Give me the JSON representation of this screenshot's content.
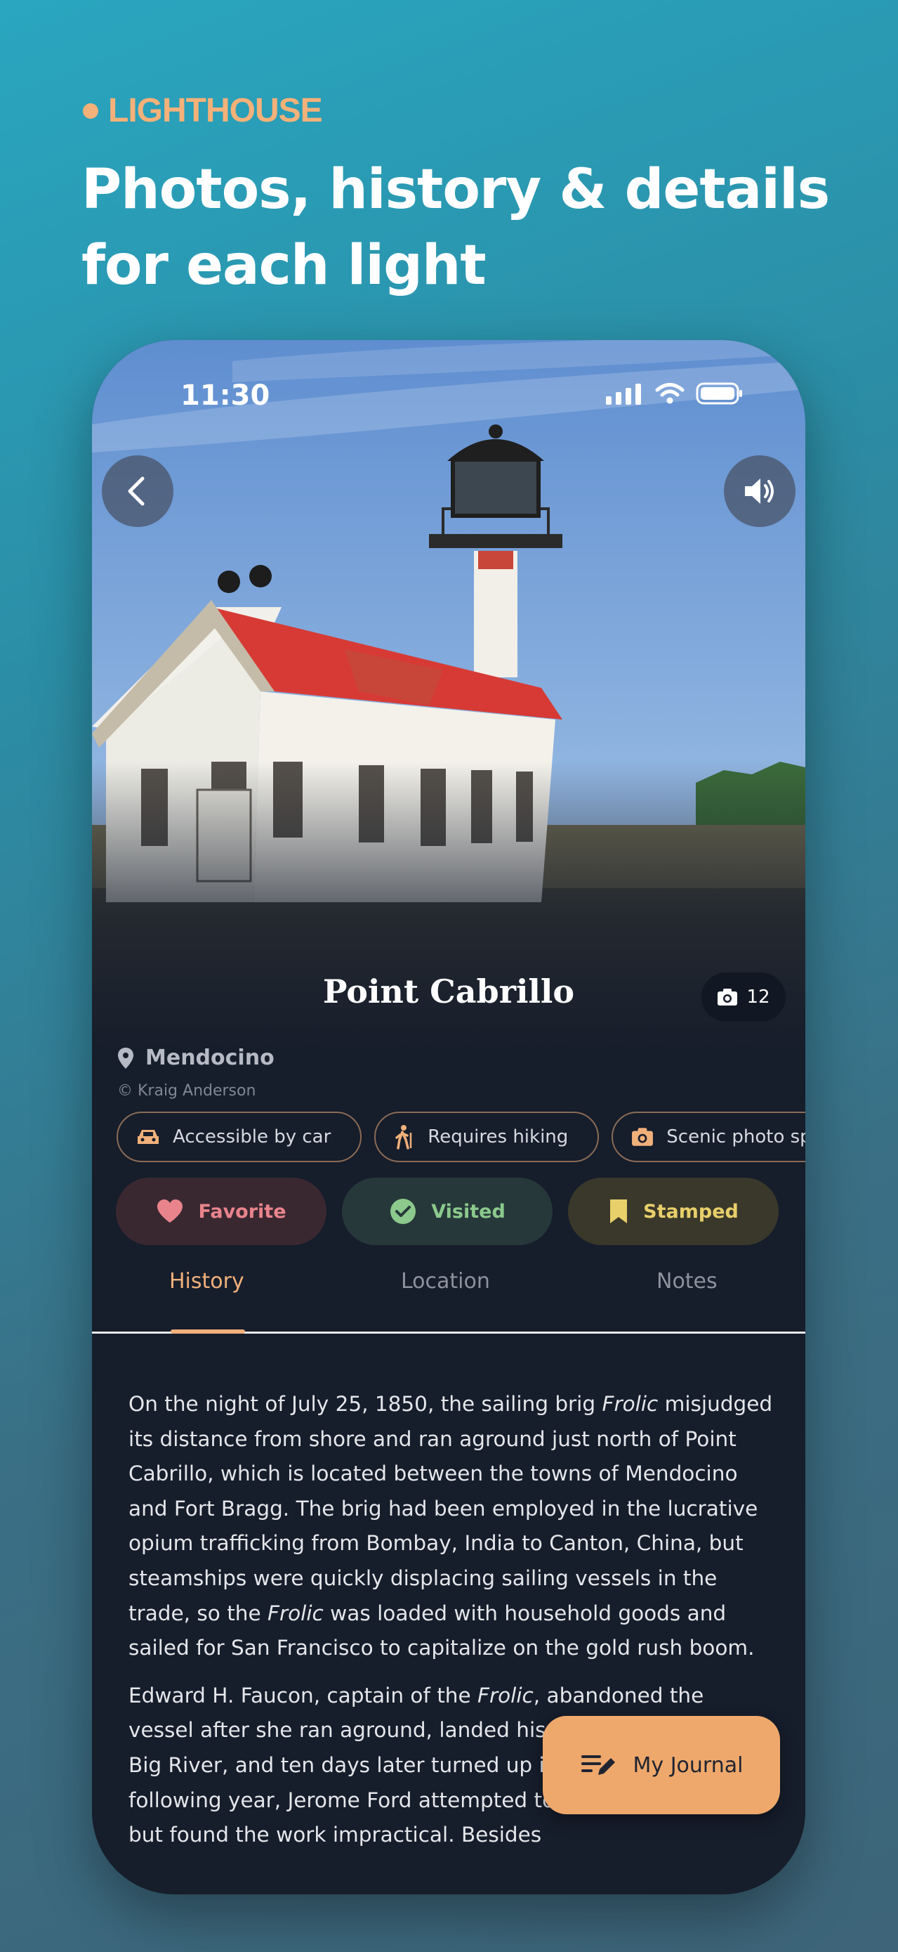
{
  "header": {
    "eyebrow": "LIGHTHOUSE",
    "headline": "Photos, history & details for each light"
  },
  "status_bar": {
    "time": "11:30"
  },
  "icons": {
    "back": "chevron-left-icon",
    "sound": "speaker-icon",
    "camera": "camera-icon",
    "pin": "map-pin-icon",
    "car": "car-icon",
    "hiking": "hiker-icon",
    "heart": "heart-icon",
    "check": "check-circle-icon",
    "bookmark": "bookmark-icon",
    "journal": "journal-edit-icon"
  },
  "lighthouse": {
    "name": "Point Cabrillo",
    "photo_count": "12",
    "location": "Mendocino",
    "photo_credit": "© Kraig Anderson"
  },
  "chips": [
    {
      "label": "Accessible by car"
    },
    {
      "label": "Requires hiking"
    },
    {
      "label": "Scenic photo sp"
    }
  ],
  "actions": {
    "favorite": "Favorite",
    "visited": "Visited",
    "stamped": "Stamped"
  },
  "tabs": {
    "history": "History",
    "location": "Location",
    "notes": "Notes"
  },
  "history": {
    "p1_a": "On the night of July 25, 1850, the sailing brig ",
    "p1_em1": "Frolic",
    "p1_b": " misjudged its distance from shore and ran aground just north of Point Cabrillo, which is located between the towns of Mendocino and Fort Bragg. The brig had been employed in the lucrative opium trafficking from Bombay, India to Canton, China, but steamships were quickly displacing sailing vessels in the trade, so the ",
    "p1_em2": "Frolic",
    "p1_c": " was loaded with household goods and sailed for San Francisco to capitalize on the gold rush boom.",
    "p2_a": "Edward H. Faucon, captain of the ",
    "p2_em": "Frolic",
    "p2_b": ", abandoned the vessel after she ran aground, landed his crew at the mouth of Big River, and ten days later turned up in San Francisco. The following year, Jerome Ford attempted to salvage the vessel, but found the work impractical. Besides"
  },
  "fab": {
    "label": "My Journal"
  },
  "colors": {
    "accent": "#f0b07a",
    "background": "#161d2b"
  }
}
